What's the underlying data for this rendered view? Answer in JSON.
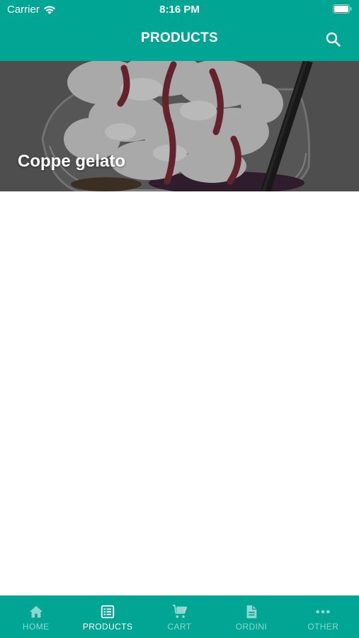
{
  "status_bar": {
    "carrier": "Carrier",
    "time": "8:16 PM"
  },
  "header": {
    "title": "PRODUCTS",
    "search_icon": "search-icon"
  },
  "categories": [
    {
      "label": "Coppe gelato",
      "image": "ice-cream-sundae-photo"
    }
  ],
  "tabbar": {
    "active": "products",
    "tabs": [
      {
        "id": "home",
        "label": "HOME",
        "icon": "home-icon"
      },
      {
        "id": "products",
        "label": "PRODUCTS",
        "icon": "list-icon"
      },
      {
        "id": "cart",
        "label": "CART",
        "icon": "cart-icon"
      },
      {
        "id": "ordini",
        "label": "ORDINI",
        "icon": "document-icon"
      },
      {
        "id": "other",
        "label": "OTHER",
        "icon": "more-icon"
      }
    ]
  },
  "colors": {
    "primary": "#00a693",
    "text_on_primary": "#ffffff"
  }
}
